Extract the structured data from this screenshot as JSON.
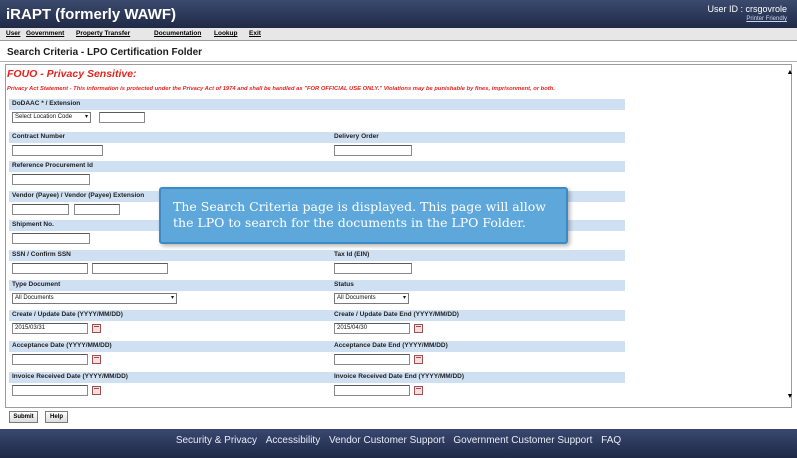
{
  "header": {
    "app_title": "iRAPT (formerly WAWF)",
    "user_id": "User ID : crsgovrole",
    "printer_friendly": "Printer Friendly"
  },
  "menu": [
    "User",
    "Government",
    "Property Transfer",
    "Documentation",
    "Lookup",
    "Exit"
  ],
  "page": {
    "title": "Search Criteria -  LPO Certification Folder",
    "fouo": "FOUO - Privacy Sensitive:",
    "privacy_statement": "Privacy Act Statement - This information is protected under the Privacy Act of 1974 and shall be handled as \"FOR OFFICIAL USE ONLY.\" Violations may be punishable by fines, imprisonment, or both."
  },
  "fields": {
    "dodaac_label": "DoDAAC *  / Extension",
    "location_select": "Select Location Code",
    "contract_label": "Contract Number",
    "delivery_label": "Delivery Order",
    "reference_label": "Reference Procurement Id",
    "vendor_label": "Vendor (Payee)  / Vendor (Payee) Extension",
    "shipment_label": "Shipment No.",
    "ssn_label": "SSN / Confirm SSN",
    "taxid_label": "Tax Id (EIN)",
    "type_doc_label": "Type Document",
    "type_doc_value": "All Documents",
    "status_label": "Status",
    "status_value": "All Documents",
    "create_label": "Create / Update Date (YYYY/MM/DD)",
    "create_value": "2015/03/31",
    "create_end_label": "Create / Update Date End (YYYY/MM/DD)",
    "create_end_value": "2015/04/30",
    "accept_label": "Acceptance Date (YYYY/MM/DD)",
    "accept_end_label": "Acceptance Date End (YYYY/MM/DD)",
    "invoice_label": "Invoice Received Date (YYYY/MM/DD)",
    "invoice_end_label": "Invoice Received Date End (YYYY/MM/DD)"
  },
  "buttons": {
    "submit": "Submit",
    "help": "Help"
  },
  "callout": {
    "text": "The Search Criteria page is displayed.  This page will allow the LPO to search for the documents in the LPO Folder."
  },
  "footer": {
    "links": [
      "Security & Privacy",
      "Accessibility",
      "Vendor Customer Support",
      "Government Customer Support",
      "FAQ"
    ]
  },
  "icons": [
    "calendar-icon",
    "dropdown-arrow-icon",
    "scroll-up-icon",
    "scroll-down-icon"
  ],
  "colors": {
    "header_bg": "#1f2a46",
    "label_bar": "#cfe0f3",
    "fouo_red": "#e3231d",
    "callout_bg": "#5ea7db"
  }
}
